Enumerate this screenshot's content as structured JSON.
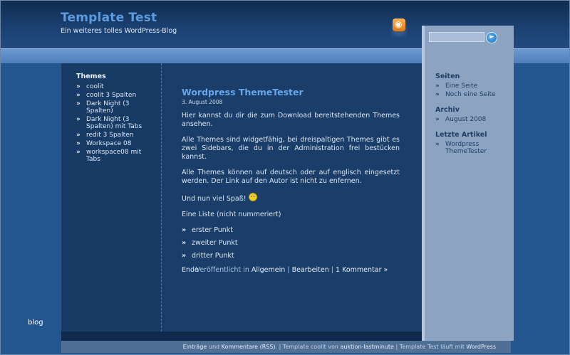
{
  "header": {
    "site_title": "Template Test",
    "tagline": "Ein weiteres tolles WordPress-Blog"
  },
  "left_sidebar": {
    "heading": "Themes",
    "items": [
      {
        "label": "coolit"
      },
      {
        "label": "coolit 3 Spalten"
      },
      {
        "label": "Dark Night (3 Spalten)"
      },
      {
        "label": "Dark Night (3 Spalten) mit Tabs"
      },
      {
        "label": "redit 3 Spalten"
      },
      {
        "label": "Workspace 08"
      },
      {
        "label": "workspace08 mit Tabs"
      }
    ]
  },
  "post": {
    "title": "Wordpress ThemeTester",
    "date": "3. August 2008",
    "paragraphs": [
      "Hier kannst du dir die zum Download bereitstehenden Themes ansehen.",
      "Alle Themes sind widgetfähig, bei dreispaltigen Themes gibt es zwei Sidebars, die du in der Administration frei bestücken kannst.",
      "Alle Themes können auf deutsch oder auf englisch eingesetzt werden. Der Link auf den Autor ist nicht zu enfernen."
    ],
    "fun_text": "Und nun viel Spaß!",
    "list_intro": "Eine Liste (nicht nummeriert)",
    "list_items": [
      "erster Punkt",
      "zweiter Punkt",
      "dritter Punkt"
    ],
    "end_text": "Ende",
    "meta": {
      "published_in": "Veröffentlicht in",
      "category": "Allgemein",
      "sep1": "|",
      "edit": "Bearbeiten",
      "sep2": "|",
      "comments": "1 Kommentar »"
    }
  },
  "right_sidebar": {
    "pages_heading": "Seiten",
    "pages": [
      {
        "label": "Eine Seite"
      },
      {
        "label": "Noch eine Seite"
      }
    ],
    "archive_heading": "Archiv",
    "archive": [
      {
        "label": "August 2008"
      }
    ],
    "recent_heading": "Letzte Artikel",
    "recent": [
      {
        "label": "Wordpress ThemeTester"
      }
    ]
  },
  "bullet_glyph": "»",
  "search": {
    "placeholder": "",
    "go_icon": "arrow-right-icon"
  },
  "rss_icon": "rss-feed-icon",
  "blog_label": "blog",
  "footer": {
    "entries": "Einträge",
    "and": "und",
    "comments": "Kommentare (RSS)",
    "sep1": ". |",
    "template_text": "Template coolit von",
    "author": "auktion-lastminute",
    "sep2": "|",
    "site": "Template Test",
    "runs_on": "läuft mit",
    "wordpress": "WordPress"
  },
  "colors": {
    "background": "#23558e",
    "content": "#1a3e69",
    "title": "#67a6ea",
    "right_panel": "#8ca4c2"
  }
}
